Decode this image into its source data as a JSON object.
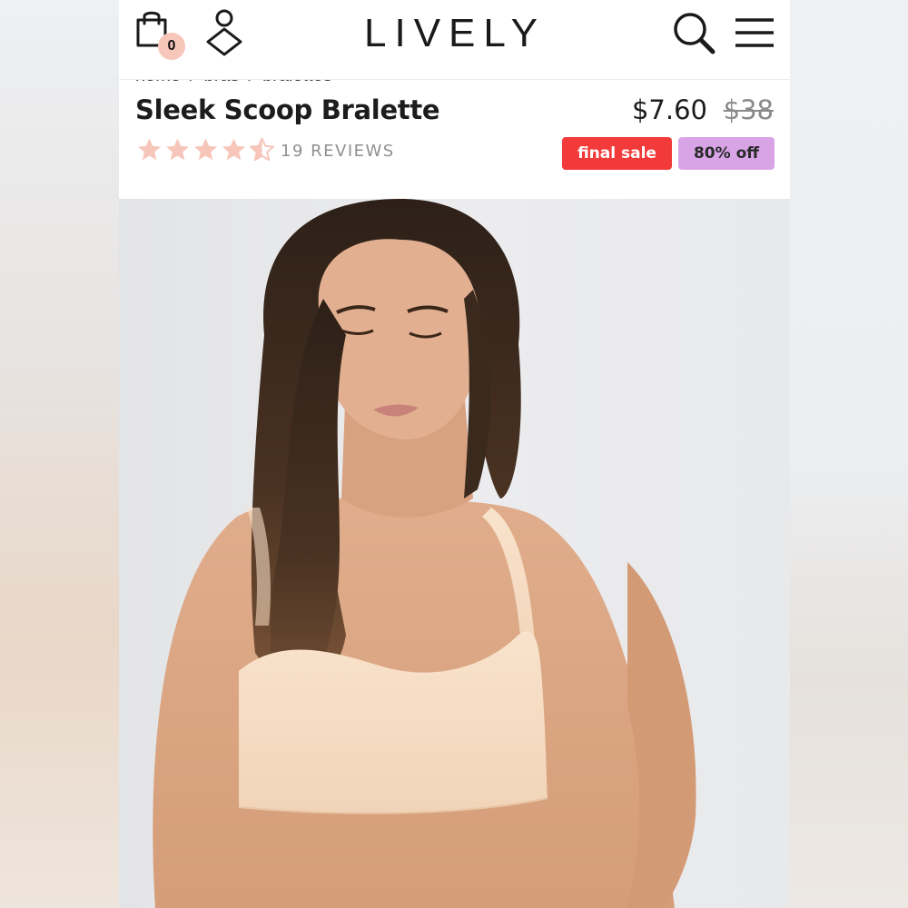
{
  "header": {
    "logo_text": "LIVELY",
    "cart_count": "0",
    "icons": [
      "shopping-bag-icon",
      "account-icon",
      "search-icon",
      "menu-icon"
    ]
  },
  "breadcrumb": {
    "items": [
      "home",
      "bras",
      "bralettes"
    ],
    "separator": "/"
  },
  "product": {
    "title": "Sleek Scoop Bralette",
    "price": "$7.60",
    "original_price": "$38",
    "rating": 4.5,
    "rating_max": 5,
    "reviews_label": "19 REVIEWS",
    "badges": {
      "final_sale": "final sale",
      "discount": "80% off"
    }
  },
  "colors": {
    "star": "#f7c6bb",
    "final_sale_badge": "#f23a3a",
    "discount_badge": "#d9a4e6",
    "cart_badge": "#f7c6bb"
  },
  "hero_image": {
    "description_icon": "product-photo"
  }
}
